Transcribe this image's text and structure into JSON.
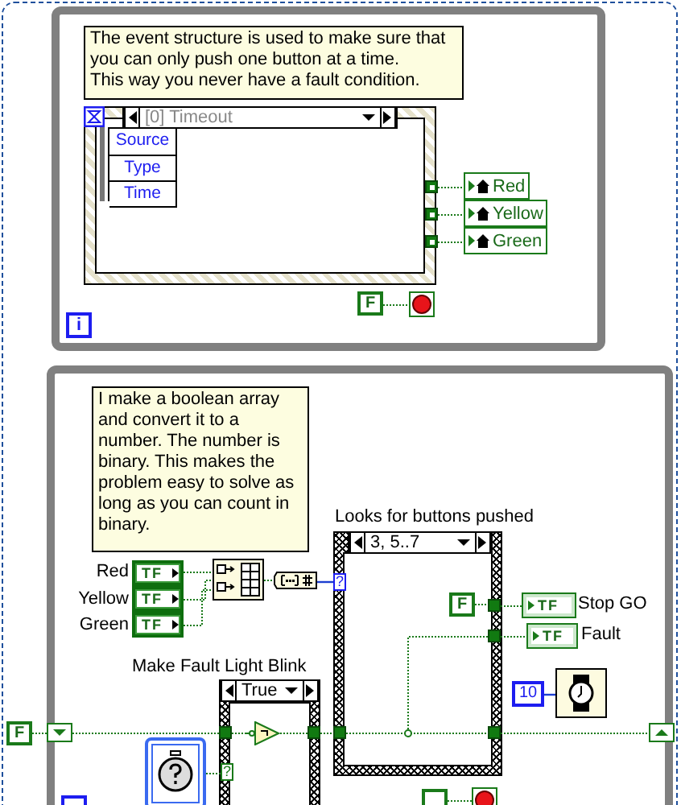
{
  "event_loop": {
    "comment": "The event structure is used to make sure that you can only push one button at a time.\nThis way you never have a fault condition.",
    "case_label": "[0] Timeout",
    "event_data": [
      "Source",
      "Type",
      "Time"
    ],
    "local_variables": [
      {
        "label": "Red"
      },
      {
        "label": "Yellow"
      },
      {
        "label": "Green"
      }
    ],
    "stop_constant": "F",
    "iteration": "i"
  },
  "logic_loop": {
    "comment": "I make a boolean array and convert it to a number. The number is binary. This makes the problem easy to solve as long as you can count in binary.",
    "case_title": "Looks for buttons pushed",
    "case_label": "3, 5..7",
    "controls": [
      {
        "label": "Red",
        "type": "TF"
      },
      {
        "label": "Yellow",
        "type": "TF"
      },
      {
        "label": "Green",
        "type": "TF"
      }
    ],
    "selector_terminal": "?",
    "false_constant": "F",
    "indicators": [
      {
        "label": "Stop GO",
        "type": "TF"
      },
      {
        "label": "Fault",
        "type": "TF"
      }
    ],
    "wait_ms": "10",
    "blink_title": "Make Fault Light Blink",
    "blink_case": "True",
    "elapsed_terminal": "?",
    "shift_init": "F"
  }
}
